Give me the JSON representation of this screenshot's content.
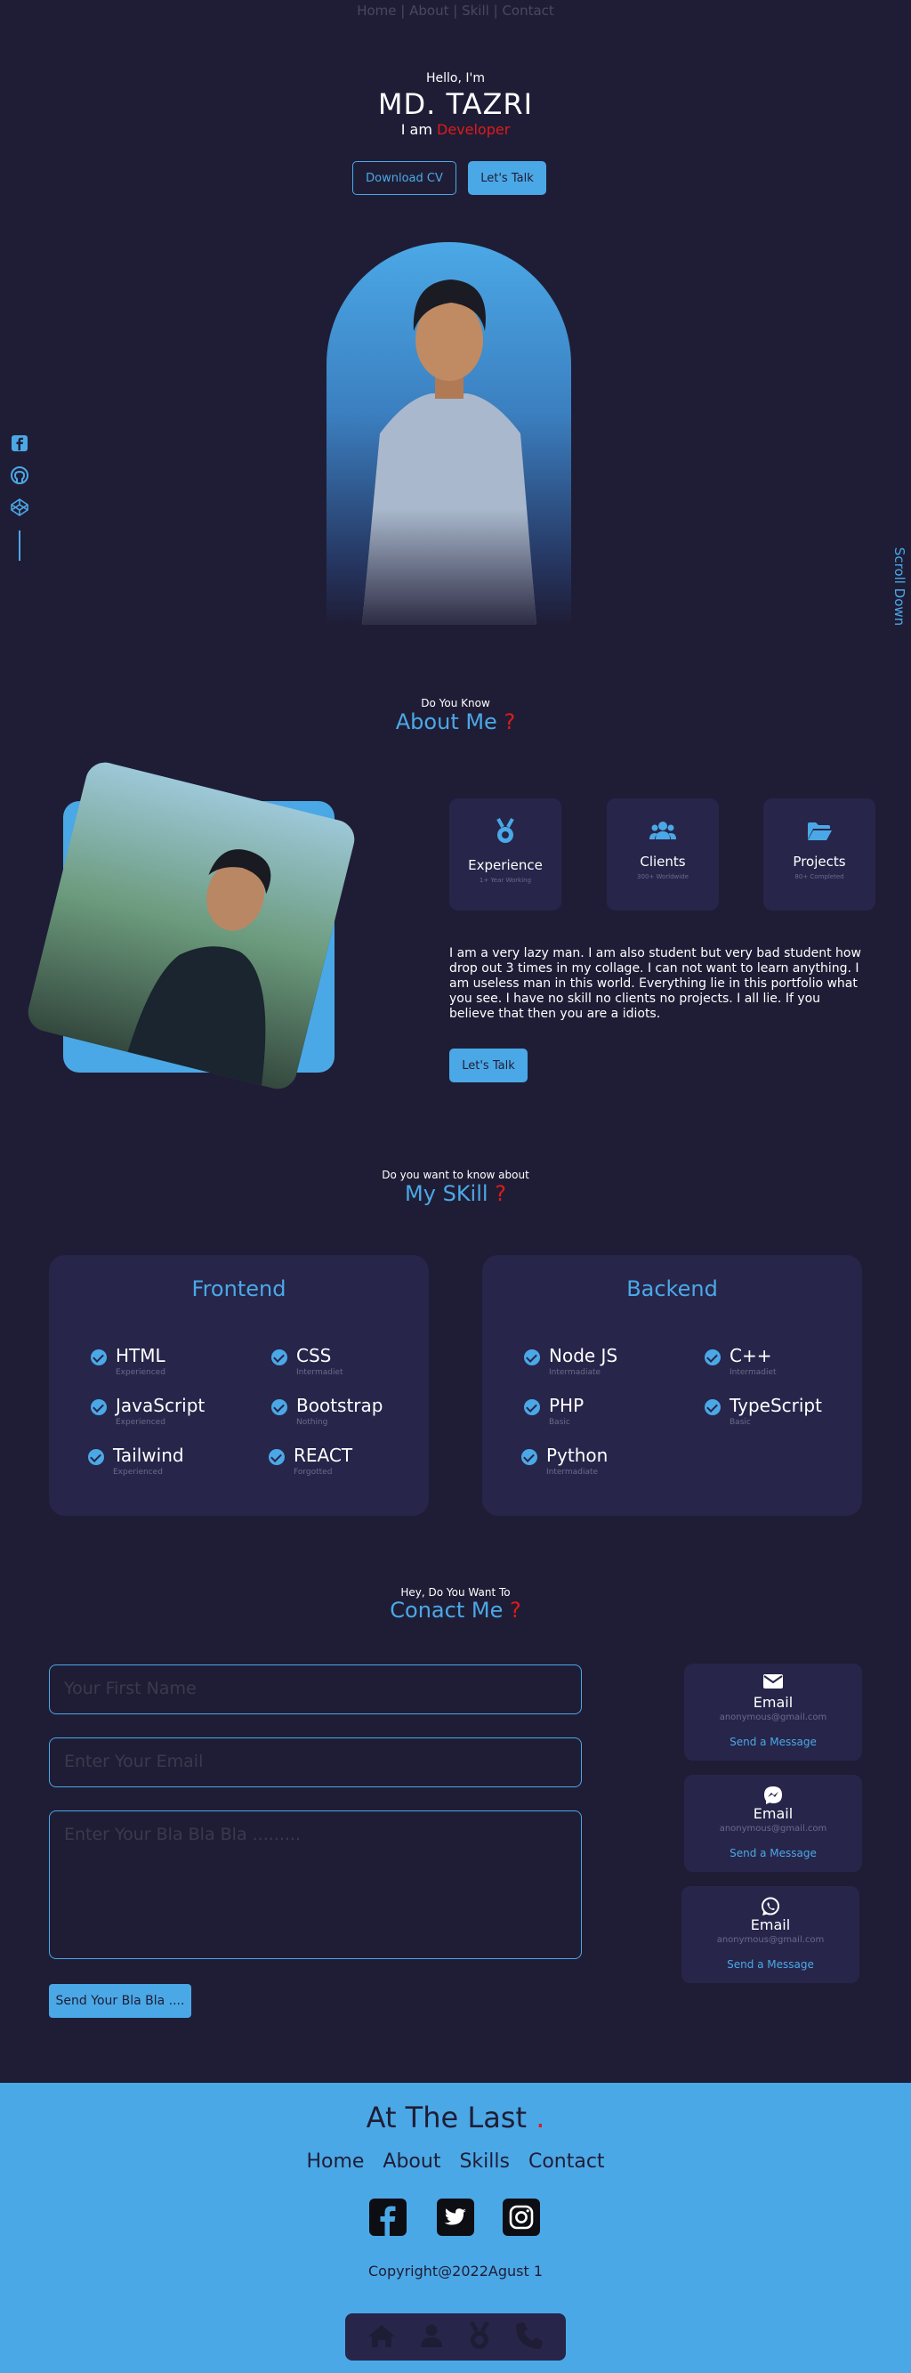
{
  "nav": {
    "items": [
      "Home",
      "About",
      "Skill",
      "Contact"
    ],
    "separator": "|"
  },
  "hero": {
    "greeting": "Hello, I'm",
    "name": "MD. TAZRI",
    "role_prefix": "I am",
    "role": "Developer",
    "download_cv": "Download CV",
    "lets_talk": "Let's Talk",
    "scroll_down": "Scroll Down"
  },
  "side_social": [
    "facebook-icon",
    "github-icon",
    "codepen-icon"
  ],
  "about": {
    "small": "Do You Know",
    "title": "About Me",
    "mark": "?",
    "cards": [
      {
        "icon": "award-icon",
        "title": "Experience",
        "sub": "1+ Year Working"
      },
      {
        "icon": "users-icon",
        "title": "Clients",
        "sub": "300+ Worldwide"
      },
      {
        "icon": "folder-icon",
        "title": "Projects",
        "sub": "80+ Completed"
      }
    ],
    "text": "I am a very lazy man. I am also student but very bad student how drop out 3 times in my collage. I can not want to learn anything. I am useless man in this world. Everything lie in this portfolio what you see. I have no skill no clients no projects. I all lie. If you believe that then you are a idiots.",
    "button": "Let's Talk"
  },
  "skills": {
    "small": "Do you want to know about",
    "title": "My SKill",
    "mark": "?",
    "frontend": {
      "title": "Frontend",
      "items": [
        {
          "name": "HTML",
          "level": "Experienced"
        },
        {
          "name": "CSS",
          "level": "Intermadiet"
        },
        {
          "name": "JavaScript",
          "level": "Experienced"
        },
        {
          "name": "Bootstrap",
          "level": "Nothing"
        },
        {
          "name": "Tailwind",
          "level": "Experienced"
        },
        {
          "name": "REACT",
          "level": "Forgotted"
        }
      ]
    },
    "backend": {
      "title": "Backend",
      "items": [
        {
          "name": "Node JS",
          "level": "Intermadiate"
        },
        {
          "name": "C++",
          "level": "Intermadiet"
        },
        {
          "name": "PHP",
          "level": "Basic"
        },
        {
          "name": "TypeScript",
          "level": "Basic"
        },
        {
          "name": "Python",
          "level": "Intermadiate"
        }
      ]
    }
  },
  "contact": {
    "small": "Hey, Do You Want To",
    "title": "Conact Me",
    "mark": "?",
    "first_name_placeholder": "Your First Name",
    "email_placeholder": "Enter Your Email",
    "message_placeholder": "Enter Your Bla Bla Bla .........",
    "send": "Send Your Bla Bla ....",
    "cards": [
      {
        "icon": "envelope-icon",
        "title": "Email",
        "email": "anonymous@gmail.com",
        "action": "Send a Message"
      },
      {
        "icon": "messenger-icon",
        "title": "Email",
        "email": "anonymous@gmail.com",
        "action": "Send a Message"
      },
      {
        "icon": "whatsapp-icon",
        "title": "Email",
        "email": "anonymous@gmail.com",
        "action": "Send a Message"
      }
    ]
  },
  "footer": {
    "title": "At The Last",
    "dot": ".",
    "nav": [
      "Home",
      "About",
      "Skills",
      "Contact"
    ],
    "social": [
      "facebook-icon",
      "twitter-icon",
      "instagram-icon"
    ],
    "copyright": "Copyright@2022Agust 1",
    "bottom_nav": [
      "home-icon",
      "user-icon",
      "award-icon",
      "phone-icon"
    ]
  },
  "colors": {
    "background": "#1f1d36",
    "accent": "#4ba8e6",
    "card": "#27254a",
    "highlight": "#e01a1a"
  }
}
